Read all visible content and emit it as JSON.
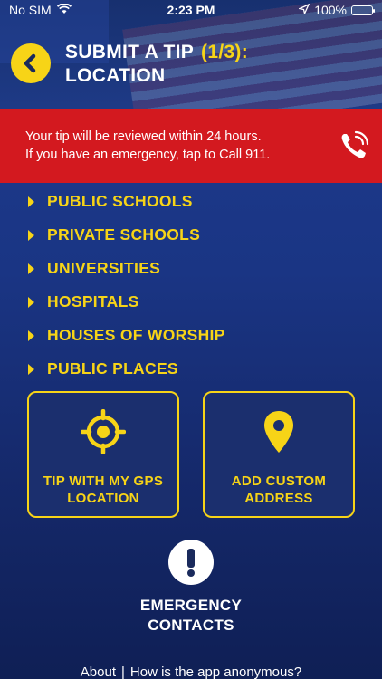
{
  "status_bar": {
    "carrier": "No SIM",
    "time": "2:23 PM",
    "battery": "100%"
  },
  "header": {
    "title_line1": "SUBMIT A TIP",
    "step": "(1/3):",
    "title_line2": "LOCATION"
  },
  "banner": {
    "line1": "Your tip will be reviewed within 24 hours.",
    "line2": "If you have an emergency, tap to Call 911."
  },
  "categories": [
    {
      "label": "PUBLIC SCHOOLS"
    },
    {
      "label": "PRIVATE SCHOOLS"
    },
    {
      "label": "UNIVERSITIES"
    },
    {
      "label": "HOSPITALS"
    },
    {
      "label": "HOUSES OF WORSHIP"
    },
    {
      "label": "PUBLIC PLACES"
    }
  ],
  "cards": {
    "gps_line1": "TIP WITH MY GPS",
    "gps_line2": "LOCATION",
    "address_line1": "ADD CUSTOM",
    "address_line2": "ADDRESS"
  },
  "emergency": {
    "line1": "EMERGENCY",
    "line2": "CONTACTS"
  },
  "footer": {
    "about": "About",
    "separator": "|",
    "anonymous": "How is the app anonymous?"
  },
  "colors": {
    "accent_yellow": "#f7d417",
    "banner_red": "#d3191f",
    "background_blue": "#1a3584"
  }
}
